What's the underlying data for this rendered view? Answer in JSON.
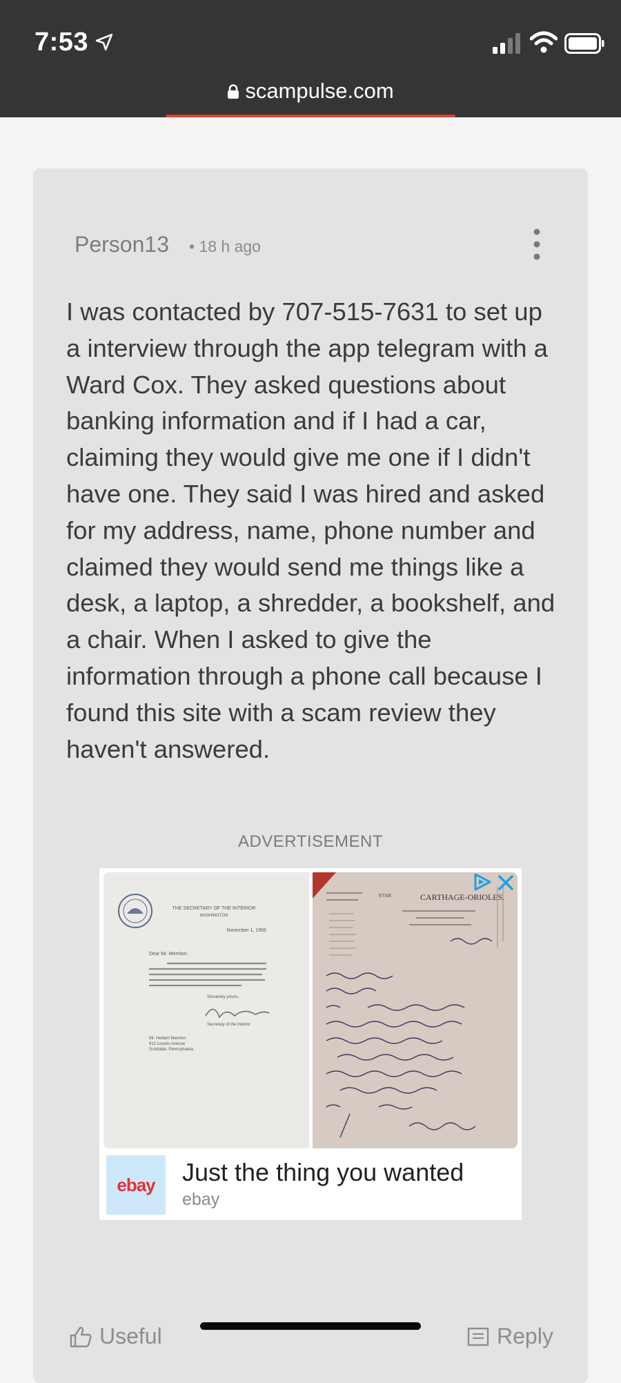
{
  "status_bar": {
    "time": "7:53",
    "icons": [
      "location-arrow-icon",
      "signal-icon",
      "wifi-icon",
      "battery-icon"
    ]
  },
  "browser": {
    "url": "scampulse.com",
    "icon": "lock-icon",
    "accent_color": "#d9442f"
  },
  "comment": {
    "author": "Person13",
    "time_ago": "• 18 h ago",
    "menu_icon": "more-vertical-icon",
    "body": "I was contacted by 707-515-7631 to set up a interview through the app telegram with a Ward Cox. They asked questions about banking information and if I had a car, claiming they would give me one if I didn't have one. They said I was hired and asked for my address, name, phone number and claimed they would send me things like a desk, a laptop, a shredder, a bookshelf, and a chair. When I asked to give the information through a phone call because I found this site with a scam review they haven't answered."
  },
  "advertisement": {
    "label": "ADVERTISEMENT",
    "headline": "Just the thing you wanted",
    "brand": "ebay",
    "logo_text": "ebay",
    "letter_left": {
      "heading_line1": "THE SECRETARY OF THE INTERIOR",
      "heading_line2": "WASHINGTON",
      "date": "November 1, 1956",
      "salutation": "Dear Mr. Merriton:",
      "closing": "Sincerely yours,",
      "signature_title": "Secretary of the Interior",
      "address_line1": "Mr. Herbert Merriton",
      "address_line2": "912 Loucks Avenue",
      "address_line3": "Scottdale, Pennsylvania"
    },
    "letter_right": {
      "club": "CARTHAGE-ORIOLES.",
      "tag": "ETAB"
    },
    "icons": [
      "adchoices-icon",
      "close-icon"
    ]
  },
  "actions": {
    "useful_label": "Useful",
    "reply_label": "Reply"
  }
}
